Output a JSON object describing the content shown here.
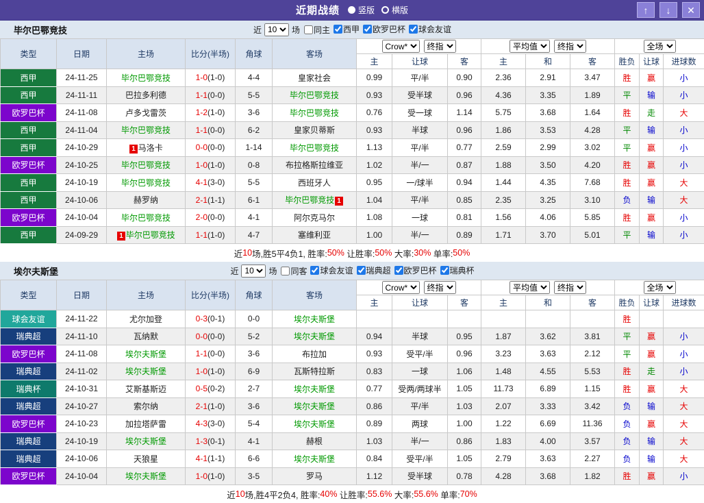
{
  "title_bar": {
    "title": "近期战绩",
    "radios": [
      {
        "label": "竖版",
        "selected": true
      },
      {
        "label": "横版",
        "selected": false
      }
    ],
    "buttons": [
      {
        "name": "up",
        "glyph": "↑"
      },
      {
        "name": "down",
        "glyph": "↓"
      },
      {
        "name": "close",
        "glyph": "✕"
      }
    ]
  },
  "colors": {
    "top_bar": "#4f4399",
    "header_bg": "#d9e3f0",
    "filter_bg": "#dee7f1",
    "team_green": "#009900",
    "score_red": "#e60000",
    "handicap_col_bg": "#fdf4ea",
    "average_col_bg": "#e9f3fb",
    "league": {
      "西甲": "#177a3e",
      "欧罗巴杯": "#7c05cc",
      "球会友谊": "#21a79b",
      "瑞典超": "#173f7d",
      "瑞典杯": "#0e7a6b"
    },
    "result": {
      "胜": "#e60000",
      "平": "#008800",
      "负": "#0000cc",
      "赢": "#e60000",
      "走": "#008800",
      "输": "#0000cc",
      "大": "#e60000",
      "小": "#0000cc"
    }
  },
  "misc": {
    "card_text": "1"
  },
  "table_header": {
    "cols": [
      "类型",
      "日期",
      "主场",
      "比分(半场)",
      "角球",
      "客场"
    ],
    "sub": [
      "主",
      "让球",
      "客",
      "主",
      "和",
      "客",
      "胜负",
      "让球",
      "进球数"
    ],
    "selects": {
      "book": "Crow*",
      "book_final": "终指",
      "avg": "平均值",
      "avg_final": "终指",
      "scope": "全场"
    }
  },
  "sections": [
    {
      "team": "毕尔巴鄂竞技",
      "filter": {
        "prefix": "近",
        "count": "10",
        "suffix": "场",
        "same_label": "同主",
        "same_checked": false,
        "leagues": [
          {
            "label": "西甲",
            "checked": true
          },
          {
            "label": "欧罗巴杯",
            "checked": true
          },
          {
            "label": "球会友谊",
            "checked": true
          }
        ]
      },
      "rows": [
        {
          "lg": "西甲",
          "date": "24-11-25",
          "home": {
            "n": "毕尔巴鄂竞技",
            "g": true
          },
          "s": "1-0",
          "h": "(1-0)",
          "c": "4-4",
          "away": {
            "n": "皇家社会"
          },
          "o": [
            "0.99",
            "平/半",
            "0.90"
          ],
          "a": [
            "2.36",
            "2.91",
            "3.47"
          ],
          "r": [
            "胜",
            "赢",
            "小"
          ]
        },
        {
          "lg": "西甲",
          "date": "24-11-11",
          "home": {
            "n": "巴拉多利德"
          },
          "s": "1-1",
          "h": "(0-0)",
          "c": "5-5",
          "away": {
            "n": "毕尔巴鄂竞技",
            "g": true
          },
          "o": [
            "0.93",
            "受半球",
            "0.96"
          ],
          "a": [
            "4.36",
            "3.35",
            "1.89"
          ],
          "r": [
            "平",
            "输",
            "小"
          ]
        },
        {
          "lg": "欧罗巴杯",
          "date": "24-11-08",
          "home": {
            "n": "卢多戈雷茨"
          },
          "s": "1-2",
          "h": "(1-0)",
          "c": "3-6",
          "away": {
            "n": "毕尔巴鄂竞技",
            "g": true
          },
          "o": [
            "0.76",
            "受一球",
            "1.14"
          ],
          "a": [
            "5.75",
            "3.68",
            "1.64"
          ],
          "r": [
            "胜",
            "走",
            "大"
          ]
        },
        {
          "lg": "西甲",
          "date": "24-11-04",
          "home": {
            "n": "毕尔巴鄂竞技",
            "g": true
          },
          "s": "1-1",
          "h": "(0-0)",
          "c": "6-2",
          "away": {
            "n": "皇家贝蒂斯"
          },
          "o": [
            "0.93",
            "半球",
            "0.96"
          ],
          "a": [
            "1.86",
            "3.53",
            "4.28"
          ],
          "r": [
            "平",
            "输",
            "小"
          ]
        },
        {
          "lg": "西甲",
          "date": "24-10-29",
          "home": {
            "n": "马洛卡",
            "card": "b"
          },
          "s": "0-0",
          "h": "(0-0)",
          "c": "1-14",
          "away": {
            "n": "毕尔巴鄂竞技",
            "g": true
          },
          "o": [
            "1.13",
            "平/半",
            "0.77"
          ],
          "a": [
            "2.59",
            "2.99",
            "3.02"
          ],
          "r": [
            "平",
            "赢",
            "小"
          ]
        },
        {
          "lg": "欧罗巴杯",
          "date": "24-10-25",
          "home": {
            "n": "毕尔巴鄂竞技",
            "g": true
          },
          "s": "1-0",
          "h": "(1-0)",
          "c": "0-8",
          "away": {
            "n": "布拉格斯拉维亚"
          },
          "o": [
            "1.02",
            "半/一",
            "0.87"
          ],
          "a": [
            "1.88",
            "3.50",
            "4.20"
          ],
          "r": [
            "胜",
            "赢",
            "小"
          ]
        },
        {
          "lg": "西甲",
          "date": "24-10-19",
          "home": {
            "n": "毕尔巴鄂竞技",
            "g": true
          },
          "s": "4-1",
          "h": "(3-0)",
          "c": "5-5",
          "away": {
            "n": "西班牙人"
          },
          "o": [
            "0.95",
            "一/球半",
            "0.94"
          ],
          "a": [
            "1.44",
            "4.35",
            "7.68"
          ],
          "r": [
            "胜",
            "赢",
            "大"
          ]
        },
        {
          "lg": "西甲",
          "date": "24-10-06",
          "home": {
            "n": "赫罗纳"
          },
          "s": "2-1",
          "h": "(1-1)",
          "c": "6-1",
          "away": {
            "n": "毕尔巴鄂竞技",
            "g": true,
            "card": "a"
          },
          "o": [
            "1.04",
            "平/半",
            "0.85"
          ],
          "a": [
            "2.35",
            "3.25",
            "3.10"
          ],
          "r": [
            "负",
            "输",
            "大"
          ]
        },
        {
          "lg": "欧罗巴杯",
          "date": "24-10-04",
          "home": {
            "n": "毕尔巴鄂竞技",
            "g": true
          },
          "s": "2-0",
          "h": "(0-0)",
          "c": "4-1",
          "away": {
            "n": "阿尔克马尔"
          },
          "o": [
            "1.08",
            "一球",
            "0.81"
          ],
          "a": [
            "1.56",
            "4.06",
            "5.85"
          ],
          "r": [
            "胜",
            "赢",
            "小"
          ]
        },
        {
          "lg": "西甲",
          "date": "24-09-29",
          "home": {
            "n": "毕尔巴鄂竞技",
            "g": true,
            "card": "b"
          },
          "s": "1-1",
          "h": "(1-0)",
          "c": "4-7",
          "away": {
            "n": "塞维利亚"
          },
          "o": [
            "1.00",
            "半/一",
            "0.89"
          ],
          "a": [
            "1.71",
            "3.70",
            "5.01"
          ],
          "r": [
            "平",
            "输",
            "小"
          ]
        }
      ],
      "summary": [
        [
          "近",
          false
        ],
        [
          "10",
          true
        ],
        [
          "场,胜5平4负1, 胜率:",
          false
        ],
        [
          "50%",
          true
        ],
        [
          " 让胜率:",
          false
        ],
        [
          "50%",
          true
        ],
        [
          " 大率:",
          false
        ],
        [
          "30%",
          true
        ],
        [
          " 单率:",
          false
        ],
        [
          "50%",
          true
        ]
      ]
    },
    {
      "team": "埃尔夫斯堡",
      "filter": {
        "prefix": "近",
        "count": "10",
        "suffix": "场",
        "same_label": "同客",
        "same_checked": false,
        "leagues": [
          {
            "label": "球会友谊",
            "checked": true
          },
          {
            "label": "瑞典超",
            "checked": true
          },
          {
            "label": "欧罗巴杯",
            "checked": true
          },
          {
            "label": "瑞典杯",
            "checked": true
          }
        ]
      },
      "rows": [
        {
          "lg": "球会友谊",
          "date": "24-11-22",
          "home": {
            "n": "尤尔加登"
          },
          "s": "0-3",
          "h": "(0-1)",
          "c": "0-0",
          "away": {
            "n": "埃尔夫斯堡",
            "g": true
          },
          "o": [
            "",
            "",
            ""
          ],
          "a": [
            "",
            "",
            ""
          ],
          "r": [
            "胜",
            "",
            ""
          ]
        },
        {
          "lg": "瑞典超",
          "date": "24-11-10",
          "home": {
            "n": "瓦纳默"
          },
          "s": "0-0",
          "h": "(0-0)",
          "c": "5-2",
          "away": {
            "n": "埃尔夫斯堡",
            "g": true
          },
          "o": [
            "0.94",
            "半球",
            "0.95"
          ],
          "a": [
            "1.87",
            "3.62",
            "3.81"
          ],
          "r": [
            "平",
            "赢",
            "小"
          ]
        },
        {
          "lg": "欧罗巴杯",
          "date": "24-11-08",
          "home": {
            "n": "埃尔夫斯堡",
            "g": true
          },
          "s": "1-1",
          "h": "(0-0)",
          "c": "3-6",
          "away": {
            "n": "布拉加"
          },
          "o": [
            "0.93",
            "受平/半",
            "0.96"
          ],
          "a": [
            "3.23",
            "3.63",
            "2.12"
          ],
          "r": [
            "平",
            "赢",
            "小"
          ]
        },
        {
          "lg": "瑞典超",
          "date": "24-11-02",
          "home": {
            "n": "埃尔夫斯堡",
            "g": true
          },
          "s": "1-0",
          "h": "(1-0)",
          "c": "6-9",
          "away": {
            "n": "瓦斯特拉斯"
          },
          "o": [
            "0.83",
            "一球",
            "1.06"
          ],
          "a": [
            "1.48",
            "4.55",
            "5.53"
          ],
          "r": [
            "胜",
            "走",
            "小"
          ]
        },
        {
          "lg": "瑞典杯",
          "date": "24-10-31",
          "home": {
            "n": "艾斯基斯迈"
          },
          "s": "0-5",
          "h": "(0-2)",
          "c": "2-7",
          "away": {
            "n": "埃尔夫斯堡",
            "g": true
          },
          "o": [
            "0.77",
            "受两/两球半",
            "1.05"
          ],
          "a": [
            "11.73",
            "6.89",
            "1.15"
          ],
          "r": [
            "胜",
            "赢",
            "大"
          ]
        },
        {
          "lg": "瑞典超",
          "date": "24-10-27",
          "home": {
            "n": "索尔纳"
          },
          "s": "2-1",
          "h": "(1-0)",
          "c": "3-6",
          "away": {
            "n": "埃尔夫斯堡",
            "g": true
          },
          "o": [
            "0.86",
            "平/半",
            "1.03"
          ],
          "a": [
            "2.07",
            "3.33",
            "3.42"
          ],
          "r": [
            "负",
            "输",
            "大"
          ]
        },
        {
          "lg": "欧罗巴杯",
          "date": "24-10-23",
          "home": {
            "n": "加拉塔萨雷"
          },
          "s": "4-3",
          "h": "(3-0)",
          "c": "5-4",
          "away": {
            "n": "埃尔夫斯堡",
            "g": true
          },
          "o": [
            "0.89",
            "两球",
            "1.00"
          ],
          "a": [
            "1.22",
            "6.69",
            "11.36"
          ],
          "r": [
            "负",
            "赢",
            "大"
          ]
        },
        {
          "lg": "瑞典超",
          "date": "24-10-19",
          "home": {
            "n": "埃尔夫斯堡",
            "g": true
          },
          "s": "1-3",
          "h": "(0-1)",
          "c": "4-1",
          "away": {
            "n": "赫根"
          },
          "o": [
            "1.03",
            "半/一",
            "0.86"
          ],
          "a": [
            "1.83",
            "4.00",
            "3.57"
          ],
          "r": [
            "负",
            "输",
            "大"
          ]
        },
        {
          "lg": "瑞典超",
          "date": "24-10-06",
          "home": {
            "n": "天狼星"
          },
          "s": "4-1",
          "h": "(1-1)",
          "c": "6-6",
          "away": {
            "n": "埃尔夫斯堡",
            "g": true
          },
          "o": [
            "0.84",
            "受平/半",
            "1.05"
          ],
          "a": [
            "2.79",
            "3.63",
            "2.27"
          ],
          "r": [
            "负",
            "输",
            "大"
          ]
        },
        {
          "lg": "欧罗巴杯",
          "date": "24-10-04",
          "home": {
            "n": "埃尔夫斯堡",
            "g": true
          },
          "s": "1-0",
          "h": "(1-0)",
          "c": "3-5",
          "away": {
            "n": "罗马"
          },
          "o": [
            "1.12",
            "受半球",
            "0.78"
          ],
          "a": [
            "4.28",
            "3.68",
            "1.82"
          ],
          "r": [
            "胜",
            "赢",
            "小"
          ]
        }
      ],
      "summary": [
        [
          "近",
          false
        ],
        [
          "10",
          true
        ],
        [
          "场,胜4平2负4, 胜率:",
          false
        ],
        [
          "40%",
          true
        ],
        [
          " 让胜率:",
          false
        ],
        [
          "55.6%",
          true
        ],
        [
          " 大率:",
          false
        ],
        [
          "55.6%",
          true
        ],
        [
          " 单率:",
          false
        ],
        [
          "70%",
          true
        ]
      ]
    }
  ]
}
